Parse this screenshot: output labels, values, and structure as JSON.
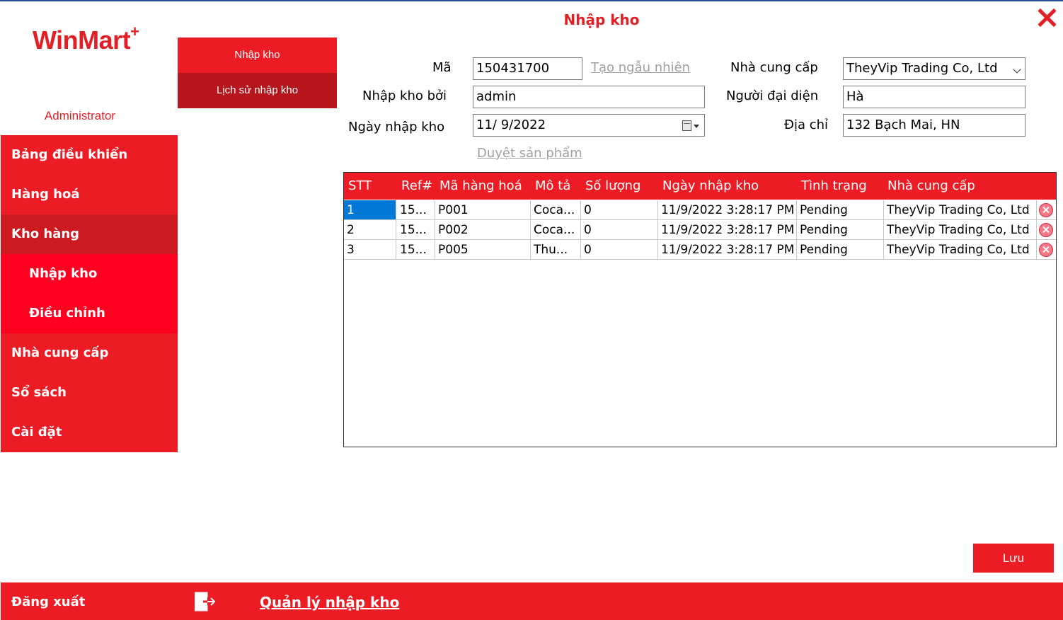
{
  "app": {
    "logo": "WinMart",
    "logo_plus": "+",
    "user": "Administrator"
  },
  "sidebar": {
    "items": [
      {
        "label": "Bảng điều khiển"
      },
      {
        "label": "Hàng hoá"
      },
      {
        "label": "Kho hàng"
      },
      {
        "label": "Nhập kho"
      },
      {
        "label": "Điều chỉnh"
      },
      {
        "label": "Nhà cung cấp"
      },
      {
        "label": "Sổ sách"
      },
      {
        "label": "Cài đặt"
      }
    ]
  },
  "submenu": {
    "import": "Nhập kho",
    "history": "Lịch sử nhập kho"
  },
  "page": {
    "title": "Nhập kho"
  },
  "form": {
    "code_label": "Mã",
    "code_value": "150431700",
    "random_link": "Tạo ngẫu nhiên",
    "by_label": "Nhập kho bởi",
    "by_value": "admin",
    "date_label": "Ngày nhập kho",
    "date_value": "11/  9/2022",
    "browse_link": "Duyệt sản phẩm",
    "supplier_label": "Nhà cung cấp",
    "supplier_value": "TheyVip Trading Co, Ltd",
    "rep_label": "Người đại diện",
    "rep_value": "Hà",
    "addr_label": "Địa chỉ",
    "addr_value": "132 Bạch Mai, HN"
  },
  "grid": {
    "columns": [
      "STT",
      "Ref#",
      "Mã hàng hoá",
      "Mô tả",
      "Số lượng",
      "Ngày nhập kho",
      "Tình trạng",
      "Nhà cung cấp"
    ],
    "rows": [
      {
        "stt": "1",
        "ref": "15...",
        "sku": "P001",
        "desc": "Coca...",
        "qty": "0",
        "date": "11/9/2022 3:28:17 PM",
        "status": "Pending",
        "supplier": "TheyVip Trading Co, Ltd"
      },
      {
        "stt": "2",
        "ref": "15...",
        "sku": "P002",
        "desc": "Coca...",
        "qty": "0",
        "date": "11/9/2022 3:28:17 PM",
        "status": "Pending",
        "supplier": "TheyVip Trading Co, Ltd"
      },
      {
        "stt": "3",
        "ref": "15...",
        "sku": "P005",
        "desc": "Thu...",
        "qty": "0",
        "date": "11/9/2022 3:28:17 PM",
        "status": "Pending",
        "supplier": "TheyVip Trading Co, Ltd"
      }
    ]
  },
  "actions": {
    "save": "Lưu"
  },
  "footer": {
    "logout": "Đăng xuất",
    "breadcrumb": "Quản lý nhập kho"
  },
  "colors": {
    "brand_red": "#ed1c24",
    "active_red": "#cd1a21",
    "sub_red": "#ff0021",
    "selection_blue": "#0078d7"
  }
}
